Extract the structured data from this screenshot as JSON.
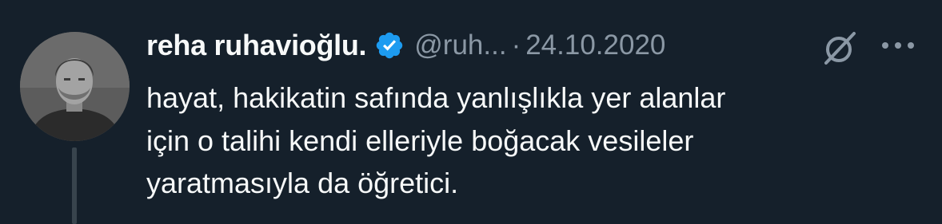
{
  "author": {
    "name": "reha ruhavioğlu.",
    "handle": "@ruh...",
    "separator": "·",
    "date": "24.10.2020",
    "verified_color": "#1d9bf0"
  },
  "tweet": {
    "lines": [
      "hayat, hakikatin safında yanlışlıkla yer alanlar",
      "için o talihi kendi elleriyle boğacak vesileler",
      "yaratmasıyla da öğretici."
    ]
  },
  "icons": {
    "verified": "verified-badge-icon",
    "grok": "grok-icon",
    "more": "more-icon"
  },
  "colors": {
    "background": "#15202b",
    "text_primary": "#f7f9f9",
    "text_secondary": "#8b98a5",
    "thread_line": "#38444d"
  }
}
